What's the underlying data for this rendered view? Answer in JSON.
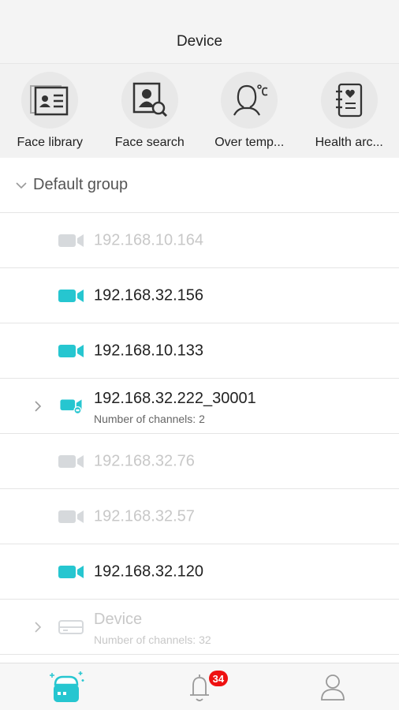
{
  "header": {
    "title": "Device"
  },
  "quick_actions": [
    {
      "label": "Face library",
      "icon": "face-library-icon"
    },
    {
      "label": "Face search",
      "icon": "face-search-icon"
    },
    {
      "label": "Over temp...",
      "icon": "over-temperature-icon"
    },
    {
      "label": "Health arc...",
      "icon": "health-archive-icon"
    }
  ],
  "group": {
    "label": "Default group"
  },
  "devices": [
    {
      "name": "192.168.10.164",
      "online": false,
      "type": "camera"
    },
    {
      "name": "192.168.32.156",
      "online": true,
      "type": "camera"
    },
    {
      "name": "192.168.10.133",
      "online": true,
      "type": "camera"
    },
    {
      "name": "192.168.32.222_30001",
      "online": true,
      "type": "camera-nvr",
      "sub": "Number of channels: 2"
    },
    {
      "name": "192.168.32.76",
      "online": false,
      "type": "camera"
    },
    {
      "name": "192.168.32.57",
      "online": false,
      "type": "camera"
    },
    {
      "name": "192.168.32.120",
      "online": true,
      "type": "camera"
    },
    {
      "name": "Device",
      "online": false,
      "type": "recorder",
      "sub": "Number of channels: 32"
    }
  ],
  "tabbar": {
    "tabs": [
      {
        "name": "devices",
        "icon": "device-tab-icon",
        "active": true
      },
      {
        "name": "alarms",
        "icon": "bell-icon",
        "badge": "34"
      },
      {
        "name": "profile",
        "icon": "user-icon"
      }
    ]
  },
  "colors": {
    "accent": "#26c6d0",
    "offline": "#d6d9dc",
    "badge": "#ee1111"
  }
}
